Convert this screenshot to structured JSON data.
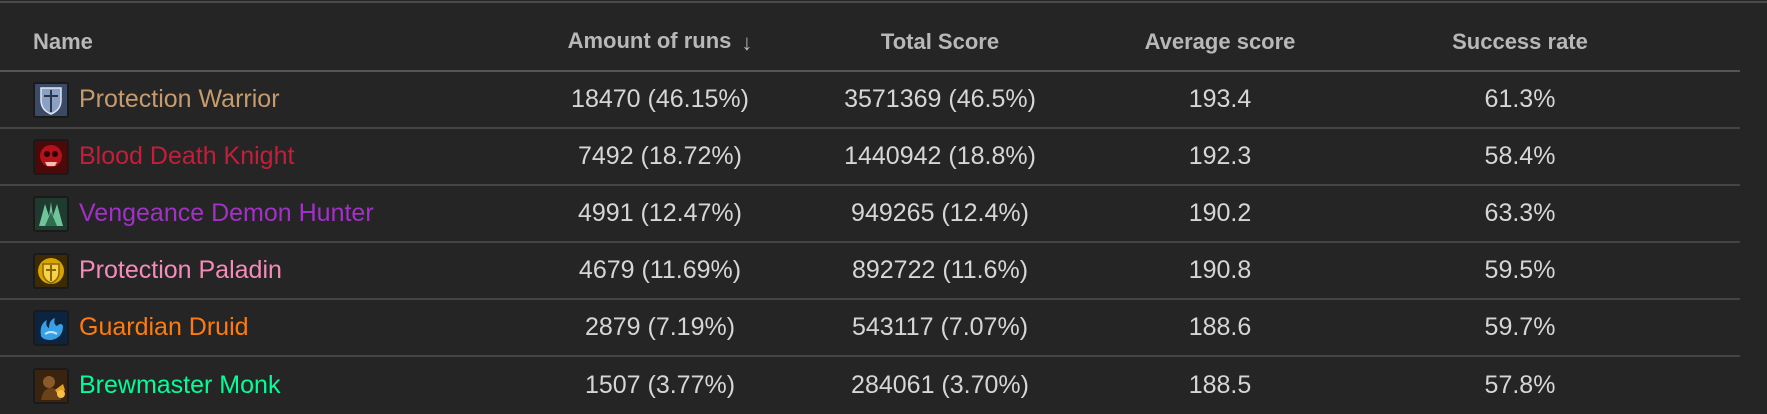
{
  "columns": {
    "name": "Name",
    "runs": "Amount of runs",
    "total": "Total Score",
    "average": "Average score",
    "success": "Success rate",
    "sort_icon": "arrow-down-icon"
  },
  "rows": [
    {
      "name": "Protection Warrior",
      "runs": "18470 (46.15%)",
      "total": "3571369 (46.5%)",
      "average": "193.4",
      "success": "61.3%",
      "color": "#c69b6d",
      "icon": "protection-warrior-icon"
    },
    {
      "name": "Blood Death Knight",
      "runs": "7492 (18.72%)",
      "total": "1440942 (18.8%)",
      "average": "192.3",
      "success": "58.4%",
      "color": "#c41e3a",
      "icon": "blood-death-knight-icon"
    },
    {
      "name": "Vengeance Demon Hunter",
      "runs": "4991 (12.47%)",
      "total": "949265 (12.4%)",
      "average": "190.2",
      "success": "63.3%",
      "color": "#a330c9",
      "icon": "vengeance-demon-hunter-icon"
    },
    {
      "name": "Protection Paladin",
      "runs": "4679 (11.69%)",
      "total": "892722 (11.6%)",
      "average": "190.8",
      "success": "59.5%",
      "color": "#f48cba",
      "icon": "protection-paladin-icon"
    },
    {
      "name": "Guardian Druid",
      "runs": "2879 (7.19%)",
      "total": "543117 (7.07%)",
      "average": "188.6",
      "success": "59.7%",
      "color": "#ff7c0a",
      "icon": "guardian-druid-icon"
    },
    {
      "name": "Brewmaster Monk",
      "runs": "1507 (3.77%)",
      "total": "284061 (3.70%)",
      "average": "188.5",
      "success": "57.8%",
      "color": "#00ff98",
      "icon": "brewmaster-monk-icon"
    }
  ]
}
